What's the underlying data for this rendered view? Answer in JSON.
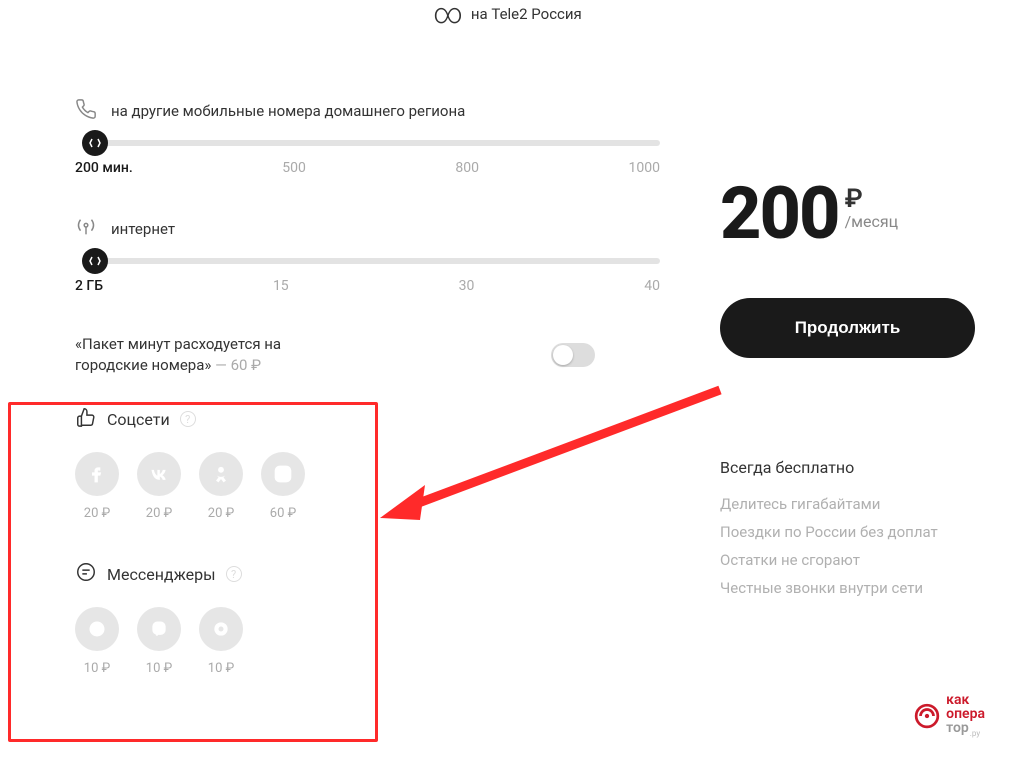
{
  "header": {
    "infinity_label": "на Tele2 Россия"
  },
  "sliders": {
    "minutes": {
      "title": "на другие мобильные номера домашнего региона",
      "ticks": [
        "200 мин.",
        "500",
        "800",
        "1000"
      ]
    },
    "internet": {
      "title": "интернет",
      "ticks": [
        "2 ГБ",
        "15",
        "30",
        "40"
      ]
    }
  },
  "option": {
    "text": "«Пакет минут расходуется на городские номера»",
    "price": "— 60 ₽"
  },
  "addons": {
    "social": {
      "title": "Соцсети",
      "items": [
        {
          "name": "facebook",
          "price": "20 ₽"
        },
        {
          "name": "vk",
          "price": "20 ₽"
        },
        {
          "name": "ok",
          "price": "20 ₽"
        },
        {
          "name": "instagram",
          "price": "60 ₽"
        }
      ]
    },
    "messengers": {
      "title": "Мессенджеры",
      "items": [
        {
          "name": "whatsapp",
          "price": "10 ₽"
        },
        {
          "name": "viber",
          "price": "10 ₽"
        },
        {
          "name": "tamtam",
          "price": "10 ₽"
        }
      ]
    }
  },
  "price": {
    "amount": "200",
    "currency": "₽",
    "period": "/месяц"
  },
  "cta": {
    "continue": "Продолжить"
  },
  "free": {
    "title": "Всегда бесплатно",
    "items": [
      "Делитесь гигабайтами",
      "Поездки по России без доплат",
      "Остатки не сгорают",
      "Честные звонки внутри сети"
    ]
  },
  "watermark": {
    "line1": "как",
    "line2": "опера",
    "line3": "тор",
    "suffix": ".ру"
  }
}
